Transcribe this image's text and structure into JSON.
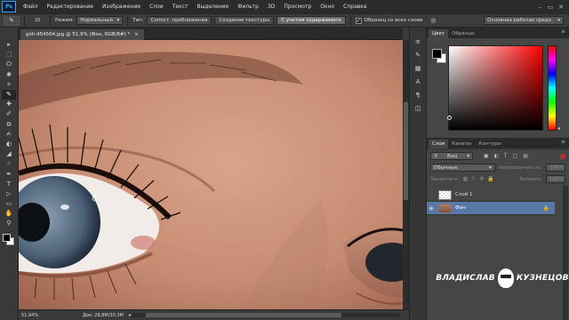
{
  "app": {
    "logo": "Ps",
    "window_controls": [
      "–",
      "▭",
      "✕"
    ]
  },
  "menu": [
    "Файл",
    "Редактирование",
    "Изображение",
    "Слои",
    "Текст",
    "Выделение",
    "Фильтр",
    "3D",
    "Просмотр",
    "Окно",
    "Справка"
  ],
  "options_bar": {
    "brush_size": "10",
    "mode_label": "Режим:",
    "mode_value": "Нормальный",
    "type_label": "Тип:",
    "type_options": [
      "Сопост. приближения",
      "Создание текстуры",
      "С учетом содержимого"
    ],
    "type_active_index": 2,
    "sample_all_layers": "Образец со всех слоев",
    "sample_all_checked": true,
    "workspace": "Основная рабочая среда"
  },
  "document": {
    "tab_title": "gidl-454564.jpg @ 51,9% (Фон, RGB/8#) *",
    "close": "×"
  },
  "status": {
    "zoom": "51,94%",
    "doc_info": "Док: 28,8M/30,3M"
  },
  "tools": [
    "▸",
    "⬚",
    "ⵔ",
    "✱",
    "⌗",
    "✎",
    "✚",
    "✐",
    "⧉",
    "✍",
    "◐",
    "◢",
    "☝",
    "✒",
    "T",
    "▷",
    "▭",
    "✋",
    "⚲"
  ],
  "tools_active_index": 5,
  "dock_icons": [
    "≡",
    "✎",
    "▦",
    "A",
    "¶",
    "◫"
  ],
  "color_panel": {
    "tabs": [
      "Цвет",
      "Образцы"
    ],
    "active_tab": 0,
    "fg": "#000000",
    "bg": "#ffffff",
    "hue_color": "#ff0000"
  },
  "layers_panel": {
    "tabs": [
      "Слои",
      "Каналы",
      "Контуры"
    ],
    "active_tab": 0,
    "filter_label": "Вид",
    "blend_mode": "Обычные",
    "opacity_label": "Непрозрачность:",
    "opacity_value": "100%",
    "lock_label": "Закрепить:",
    "fill_label": "Заливка:",
    "fill_value": "100%",
    "layers": [
      {
        "name": "Слой 1",
        "visible": false,
        "thumb": "checker",
        "selected": false,
        "locked": false
      },
      {
        "name": "Фон",
        "visible": true,
        "thumb": "photo",
        "selected": true,
        "locked": true
      }
    ],
    "footer_icons": [
      "⊂⊃",
      "fx",
      "◙",
      "◍",
      "▭",
      "⊞",
      "🗑"
    ]
  },
  "watermark": {
    "left": "ВЛАДИСЛАВ",
    "right": "КУЗНЕЦОВ"
  },
  "colors": {
    "selected_layer": "#5a78a6",
    "ps_blue": "#31a8ff"
  }
}
